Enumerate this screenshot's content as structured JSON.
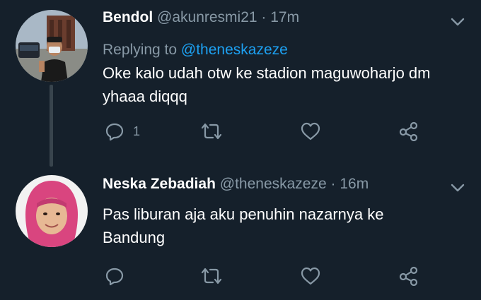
{
  "tweets": [
    {
      "name": "Bendol",
      "handle": "@akunresmi21",
      "separator": "·",
      "time": "17m",
      "replying_prefix": "Replying to",
      "replying_to": "@theneskazeze",
      "text_line1": "Oke kalo udah otw ke stadion maguwoharjo dm",
      "text_line2": "yhaaa diqqq",
      "reply_count": "1",
      "avatar_icon": "user-photo-man-mask"
    },
    {
      "name": "Neska Zebadiah",
      "handle": "@theneskazeze",
      "separator": "·",
      "time": "16m",
      "text_line1": "Pas liburan aja aku penuhin nazarnya ke",
      "text_line2": "Bandung",
      "avatar_icon": "user-photo-girl-pink-hijab"
    }
  ],
  "icons": {
    "reply": "reply-icon",
    "retweet": "retweet-icon",
    "like": "heart-icon",
    "share": "share-icon",
    "caret": "chevron-down-icon"
  },
  "colors": {
    "background": "#15202b",
    "secondary_text": "#8899a6",
    "link": "#1da1f2",
    "thread_line": "#38444d"
  }
}
